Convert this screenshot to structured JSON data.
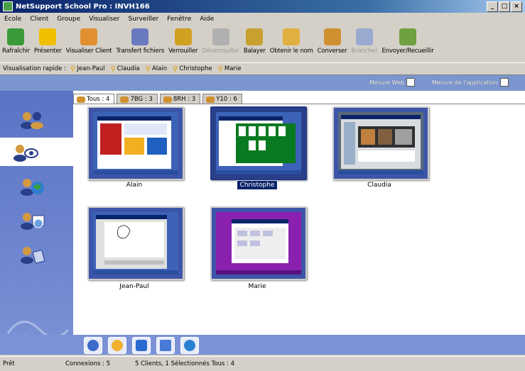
{
  "window": {
    "title": "NetSupport School Pro : INVH166",
    "min": "_",
    "max": "□",
    "close": "×"
  },
  "menu": [
    "Ecole",
    "Client",
    "Groupe",
    "Visualiser",
    "Surveiller",
    "Fenêtre",
    "Aide"
  ],
  "toolbar": [
    {
      "label": "Rafraîchir",
      "icon": "refresh-icon",
      "color": "#3a9a3a"
    },
    {
      "label": "Présenter",
      "icon": "present-icon",
      "color": "#f0c000"
    },
    {
      "label": "Visualiser Client",
      "icon": "view-client-icon",
      "color": "#e09030"
    },
    {
      "label": "Transfert fichiers",
      "icon": "file-transfer-icon",
      "color": "#6a7ac0"
    },
    {
      "label": "Verrouiller",
      "icon": "lock-icon",
      "color": "#d0a020"
    },
    {
      "label": "Déverrouiller",
      "icon": "unlock-icon",
      "color": "#b0b0b0",
      "disabled": true
    },
    {
      "label": "Balayer",
      "icon": "scan-icon",
      "color": "#c8a030"
    },
    {
      "label": "Obtenir le nom",
      "icon": "get-name-icon",
      "color": "#e0b040"
    },
    {
      "label": "Converser",
      "icon": "chat-icon",
      "color": "#d09030"
    },
    {
      "label": "Brancher",
      "icon": "connect-icon",
      "color": "#9aaad0",
      "disabled": true
    },
    {
      "label": "Envoyer/Recueillir",
      "icon": "send-collect-icon",
      "color": "#70a040"
    }
  ],
  "quick_view": {
    "label": "Visualisation rapide :",
    "items": [
      "Jean-Paul",
      "Claudia",
      "Alain",
      "Christophe",
      "Marie"
    ]
  },
  "measures": {
    "web": "Mesure Web",
    "app": "Mesure de l'application"
  },
  "tabs": [
    {
      "label": "Tous : 4",
      "active": true
    },
    {
      "label": "7BG : 3",
      "active": false
    },
    {
      "label": "8RH : 3",
      "active": false
    },
    {
      "label": "Y10 : 6",
      "active": false
    }
  ],
  "clients": [
    {
      "name": "Alain",
      "selected": false,
      "theme": "browser"
    },
    {
      "name": "Christophe",
      "selected": true,
      "theme": "solitaire"
    },
    {
      "name": "Claudia",
      "selected": false,
      "theme": "media"
    },
    {
      "name": "Jean-Paul",
      "selected": false,
      "theme": "paint"
    },
    {
      "name": "Marie",
      "selected": false,
      "theme": "purple"
    }
  ],
  "sidebar_icons": [
    "group-icon",
    "view-icon",
    "web-icon",
    "apps-icon",
    "notes-icon"
  ],
  "bottom_icons": [
    "check-icon",
    "search-icon",
    "monitor-icon",
    "grid-icon",
    "globe-icon"
  ],
  "status": {
    "ready": "Prêt",
    "connections": "Connexions : 5",
    "summary": "5 Clients, 1 Sélectionnés  Tous : 4"
  }
}
